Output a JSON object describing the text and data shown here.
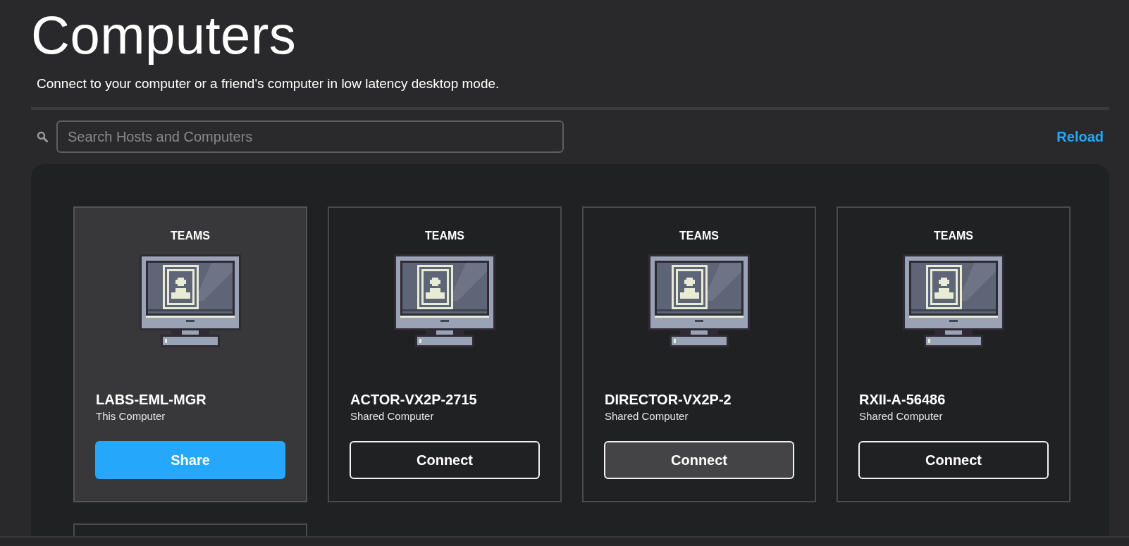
{
  "page": {
    "title": "Computers",
    "subtitle": "Connect to your computer or a friend's computer in low latency desktop mode."
  },
  "search": {
    "placeholder": "Search Hosts and Computers"
  },
  "reload": "Reload",
  "computers": [
    {
      "group": "TEAMS",
      "name": "LABS-EML-MGR",
      "description": "This Computer",
      "highlighted": true,
      "button": {
        "kind": "share",
        "label": "Share",
        "hovered": false
      }
    },
    {
      "group": "TEAMS",
      "name": "ACTOR-VX2P-2715",
      "description": "Shared Computer",
      "highlighted": false,
      "button": {
        "kind": "connect",
        "label": "Connect",
        "hovered": false
      }
    },
    {
      "group": "TEAMS",
      "name": "DIRECTOR-VX2P-2",
      "description": "Shared Computer",
      "highlighted": false,
      "button": {
        "kind": "connect",
        "label": "Connect",
        "hovered": true
      }
    },
    {
      "group": "TEAMS",
      "name": "RXII-A-56486",
      "description": "Shared Computer",
      "highlighted": false,
      "button": {
        "kind": "connect",
        "label": "Connect",
        "hovered": false
      }
    }
  ]
}
